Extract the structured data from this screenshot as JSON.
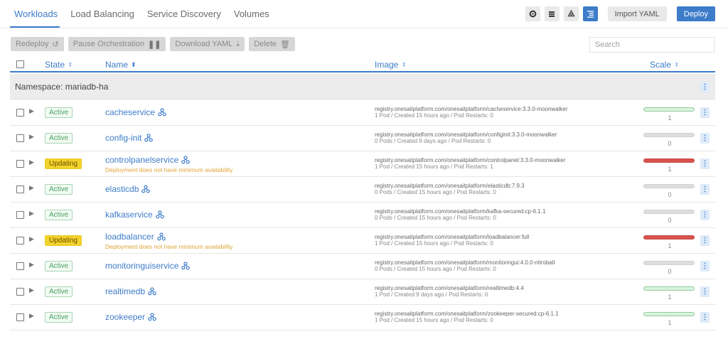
{
  "tabs": [
    {
      "label": "Workloads",
      "active": true
    },
    {
      "label": "Load Balancing",
      "active": false
    },
    {
      "label": "Service Discovery",
      "active": false
    },
    {
      "label": "Volumes",
      "active": false
    }
  ],
  "toolbar": {
    "view_icons": [
      "gear-icon",
      "list-icon",
      "node-icon",
      "grouped-list-icon"
    ],
    "import_label": "Import YAML",
    "deploy_label": "Deploy"
  },
  "bulk_actions": {
    "redeploy": "Redeploy",
    "pause": "Pause Orchestration",
    "download": "Download YAML",
    "delete": "Delete"
  },
  "search": {
    "placeholder": "Search",
    "value": ""
  },
  "columns": {
    "state": "State",
    "name": "Name",
    "image": "Image",
    "scale": "Scale"
  },
  "namespace": {
    "label": "Namespace: mariadb-ha"
  },
  "colors": {
    "accent": "#3d7cc9",
    "active": "#4aa05d",
    "updating": "#f3d32b",
    "warning": "#e0a437",
    "scale_bad": "#d9534f"
  },
  "rows": [
    {
      "state": "Active",
      "state_kind": "active",
      "name": "cacheservice",
      "warning": "",
      "image": "registry.onesaitplatform.com/onesaitplatform/cacheservice:3.3.0-moonwalker",
      "detail": "1 Pod / Created 15 hours ago / Pod Restarts: 0",
      "scale": "1",
      "scale_kind": "ok"
    },
    {
      "state": "Active",
      "state_kind": "active",
      "name": "config-init",
      "warning": "",
      "image": "registry.onesaitplatform.com/onesaitplatform/configinit:3.3.0-moonwalker",
      "detail": "0 Pods / Created 9 days ago / Pod Restarts: 0",
      "scale": "0",
      "scale_kind": "zero"
    },
    {
      "state": "Updating",
      "state_kind": "updating",
      "name": "controlpanelservice",
      "warning": "Deployment does not have minimum availability",
      "image": "registry.onesaitplatform.com/onesaitplatform/controlpanel:3.3.0-moonwalker",
      "detail": "1 Pod / Created 15 hours ago / Pod Restarts: 1",
      "scale": "1",
      "scale_kind": "bad"
    },
    {
      "state": "Active",
      "state_kind": "active",
      "name": "elasticdb",
      "warning": "",
      "image": "registry.onesaitplatform.com/onesaitplatform/elasticdb:7.9.3",
      "detail": "0 Pods / Created 15 hours ago / Pod Restarts: 0",
      "scale": "0",
      "scale_kind": "zero"
    },
    {
      "state": "Active",
      "state_kind": "active",
      "name": "kafkaservice",
      "warning": "",
      "image": "registry.onesaitplatform.com/onesaitplatform/kafka-secured:cp-6.1.1",
      "detail": "0 Pods / Created 15 hours ago / Pod Restarts: 0",
      "scale": "0",
      "scale_kind": "zero"
    },
    {
      "state": "Updating",
      "state_kind": "updating",
      "name": "loadbalancer",
      "warning": "Deployment does not have minimum availability",
      "image": "registry.onesaitplatform.com/onesaitplatform/loadbalancer:full",
      "detail": "1 Pod / Created 15 hours ago / Pod Restarts: 0",
      "scale": "1",
      "scale_kind": "bad"
    },
    {
      "state": "Active",
      "state_kind": "active",
      "name": "monitoringuiservice",
      "warning": "",
      "image": "registry.onesaitplatform.com/onesaitplatform/monitoringui:4.0.0-nitroball",
      "detail": "0 Pods / Created 15 hours ago / Pod Restarts: 0",
      "scale": "0",
      "scale_kind": "zero"
    },
    {
      "state": "Active",
      "state_kind": "active",
      "name": "realtimedb",
      "warning": "",
      "image": "registry.onesaitplatform.com/onesaitplatform/realtimedb:4.4",
      "detail": "1 Pod / Created 9 days ago / Pod Restarts: 0",
      "scale": "1",
      "scale_kind": "ok"
    },
    {
      "state": "Active",
      "state_kind": "active",
      "name": "zookeeper",
      "warning": "",
      "image": "registry.onesaitplatform.com/onesaitplatform/zookeeper-secured:cp-6.1.1",
      "detail": "1 Pod / Created 15 hours ago / Pod Restarts: 0",
      "scale": "1",
      "scale_kind": "ok"
    }
  ]
}
